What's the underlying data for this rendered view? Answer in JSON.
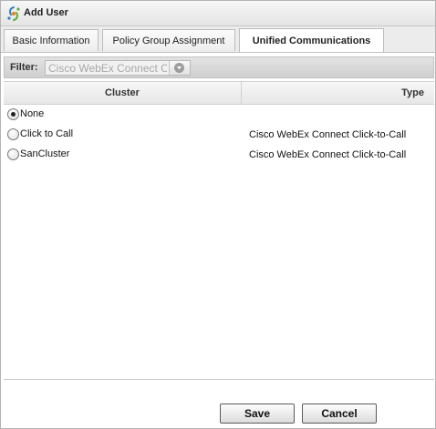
{
  "dialog": {
    "title": "Add User"
  },
  "tabs": [
    {
      "label": "Basic Information"
    },
    {
      "label": "Policy Group Assignment"
    },
    {
      "label": "Unified Communications"
    }
  ],
  "filter": {
    "label": "Filter:",
    "value": "Cisco WebEx Connect Click-to-Call"
  },
  "grid": {
    "columns": {
      "cluster": "Cluster",
      "type": "Type"
    },
    "rows": [
      {
        "name": "None",
        "type": "",
        "selected": true
      },
      {
        "name": "Click to Call",
        "type": "Cisco WebEx Connect Click-to-Call",
        "selected": false
      },
      {
        "name": "SanCluster",
        "type": "Cisco WebEx Connect Click-to-Call",
        "selected": false
      }
    ]
  },
  "buttons": {
    "save": "Save",
    "cancel": "Cancel"
  },
  "icons": {
    "title": "connect-logo-icon",
    "filter_dropdown": "chevron-down-icon"
  },
  "colors": {
    "logo_blue": "#2f7fc8",
    "logo_green": "#5fae3a",
    "logo_orange": "#e58a1f"
  }
}
